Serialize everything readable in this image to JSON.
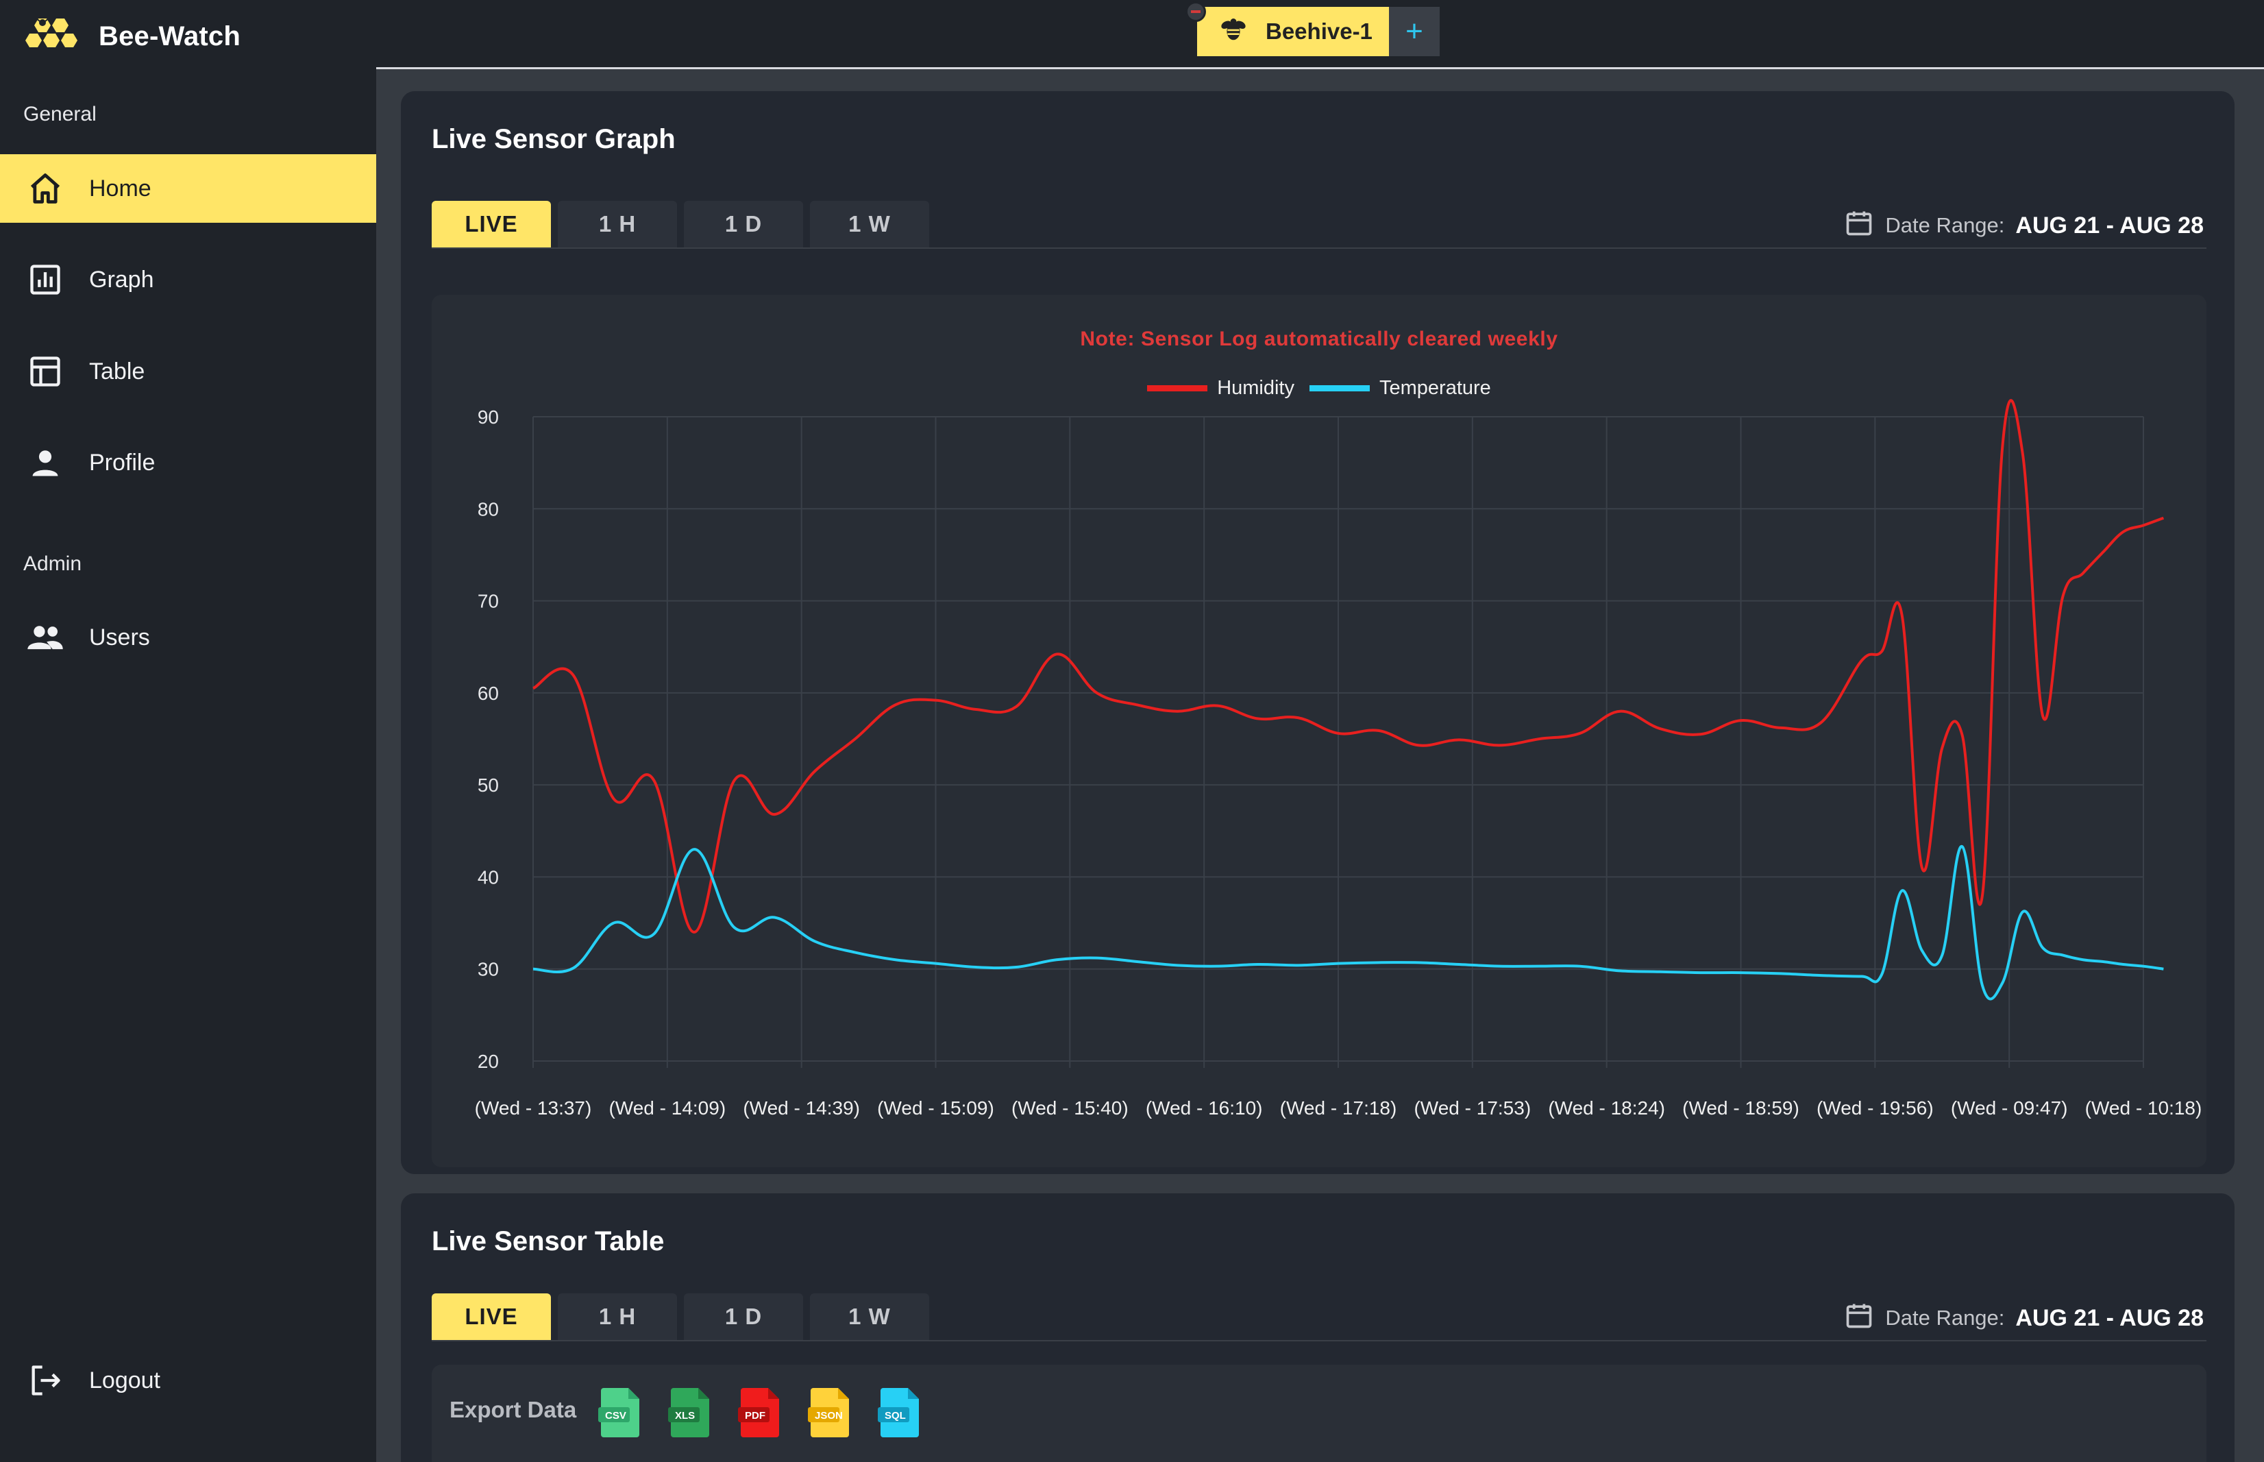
{
  "app": {
    "title": "Bee-Watch"
  },
  "sidebar": {
    "sections": [
      {
        "label": "General"
      },
      {
        "label": "Admin"
      }
    ],
    "items": [
      {
        "label": "Home",
        "icon": "home-icon",
        "active": true
      },
      {
        "label": "Graph",
        "icon": "bar-chart-icon",
        "active": false
      },
      {
        "label": "Table",
        "icon": "table-icon",
        "active": false
      },
      {
        "label": "Profile",
        "icon": "person-icon",
        "active": false
      },
      {
        "label": "Users",
        "icon": "users-icon",
        "active": false
      }
    ],
    "logout_label": "Logout"
  },
  "topbar": {
    "hive_tab_label": "Beehive-1",
    "add_tab_label": "+"
  },
  "colors": {
    "accent": "#ffe567",
    "humidity": "#e8201f",
    "temperature": "#27d0f5",
    "note": "#e03a3a"
  },
  "graph_card": {
    "title": "Live Sensor Graph",
    "range_tabs": [
      "LIVE",
      "1 H",
      "1 D",
      "1 W"
    ],
    "active_range": "LIVE",
    "date_range_label": "Date Range:",
    "date_range_value": "AUG 21 - AUG 28",
    "note": "Note: Sensor Log automatically cleared weekly"
  },
  "table_card": {
    "title": "Live Sensor Table",
    "range_tabs": [
      "LIVE",
      "1 H",
      "1 D",
      "1 W"
    ],
    "active_range": "LIVE",
    "date_range_label": "Date Range:",
    "date_range_value": "AUG 21 - AUG 28",
    "export_label": "Export Data",
    "export_formats": [
      "CSV",
      "XLS",
      "PDF",
      "JSON",
      "SQL"
    ]
  },
  "chart_data": {
    "type": "line",
    "title": "",
    "xlabel": "",
    "ylabel": "",
    "ylim": [
      20,
      90
    ],
    "yticks": [
      90,
      80,
      70,
      60,
      50,
      40,
      30,
      20
    ],
    "grid": true,
    "legend_position": "top",
    "x_tick_labels": [
      "(Wed - 13:37)",
      "(Wed - 14:09)",
      "(Wed - 14:39)",
      "(Wed - 15:09)",
      "(Wed - 15:40)",
      "(Wed - 16:10)",
      "(Wed - 17:18)",
      "(Wed - 17:53)",
      "(Wed - 18:24)",
      "(Wed - 18:59)",
      "(Wed - 19:56)",
      "(Wed - 09:47)",
      "(Wed - 10:18)"
    ],
    "x": [
      0,
      0.3,
      0.6,
      0.9,
      1.2,
      1.5,
      1.8,
      2.1,
      2.4,
      2.7,
      3.0,
      3.3,
      3.6,
      3.9,
      4.2,
      4.5,
      4.8,
      5.1,
      5.4,
      5.7,
      6.0,
      6.3,
      6.6,
      6.9,
      7.2,
      7.5,
      7.8,
      8.1,
      8.4,
      8.7,
      9.0,
      9.3,
      9.6,
      9.9,
      10.05,
      10.2,
      10.35,
      10.5,
      10.65,
      10.8,
      10.95,
      11.1,
      11.25,
      11.4,
      11.55,
      11.7,
      11.85,
      12.0,
      12.15
    ],
    "series": [
      {
        "name": "Humidity",
        "color": "#e8201f",
        "values": [
          60.5,
          61.9,
          48.5,
          50.5,
          34,
          50.5,
          46.8,
          51.5,
          55,
          58.7,
          59.2,
          58.2,
          58.5,
          64.2,
          60,
          58.7,
          58,
          58.6,
          57.2,
          57.3,
          55.6,
          55.9,
          54.3,
          54.9,
          54.3,
          55,
          55.6,
          58,
          56.1,
          55.5,
          57,
          56.2,
          56.8,
          63.5,
          64.5,
          68.5,
          41,
          54,
          55.4,
          38,
          86.8,
          86,
          57.5,
          70.5,
          73,
          75.3,
          77.5,
          78.2,
          79
        ]
      },
      {
        "name": "Temperature",
        "color": "#27d0f5",
        "values": [
          30,
          30.1,
          35,
          33.8,
          43,
          34.5,
          35.6,
          33,
          31.8,
          31,
          30.6,
          30.2,
          30.2,
          31,
          31.2,
          30.8,
          30.4,
          30.3,
          30.5,
          30.4,
          30.6,
          30.7,
          30.7,
          30.5,
          30.3,
          30.3,
          30.3,
          29.8,
          29.7,
          29.6,
          29.6,
          29.5,
          29.3,
          29.2,
          29.4,
          38.5,
          32,
          31.5,
          43.3,
          28.2,
          28.5,
          36.2,
          32.3,
          31.5,
          31,
          30.8,
          30.5,
          30.3,
          30
        ]
      }
    ]
  }
}
